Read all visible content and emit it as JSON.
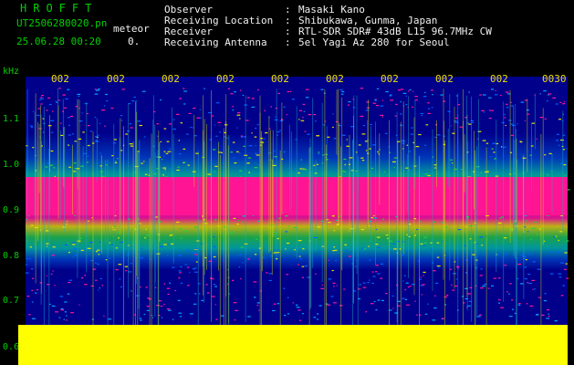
{
  "app": {
    "brand": "HROFFT",
    "filename": "UT2506280020.pn",
    "mode_label": "meteor",
    "datetime": "25.06.28 00:20",
    "counter": "0."
  },
  "info": [
    {
      "key": "Observer",
      "value": "Masaki Kano"
    },
    {
      "key": "Receiving Location",
      "value": "Shibukawa, Gunma, Japan"
    },
    {
      "key": "Receiver",
      "value": "RTL-SDR SDR# 43dB L15 96.7MHz CW"
    },
    {
      "key": "Receiving Antenna",
      "value": "5el Yagi Az 280 for Seoul"
    }
  ],
  "axis": {
    "unit": "kHz",
    "freq_ticks": [
      "1.1",
      "1.0",
      "0.9",
      "0.8",
      "0.7",
      "0.6"
    ],
    "time_ticks": [
      "002",
      "002",
      "002",
      "002",
      "002",
      "002",
      "002",
      "002",
      "002",
      "0030"
    ]
  },
  "colors": {
    "noise_floor": "#ffff00",
    "strong": "#ff1493",
    "background": "#00008b",
    "text": "#00d000"
  }
}
